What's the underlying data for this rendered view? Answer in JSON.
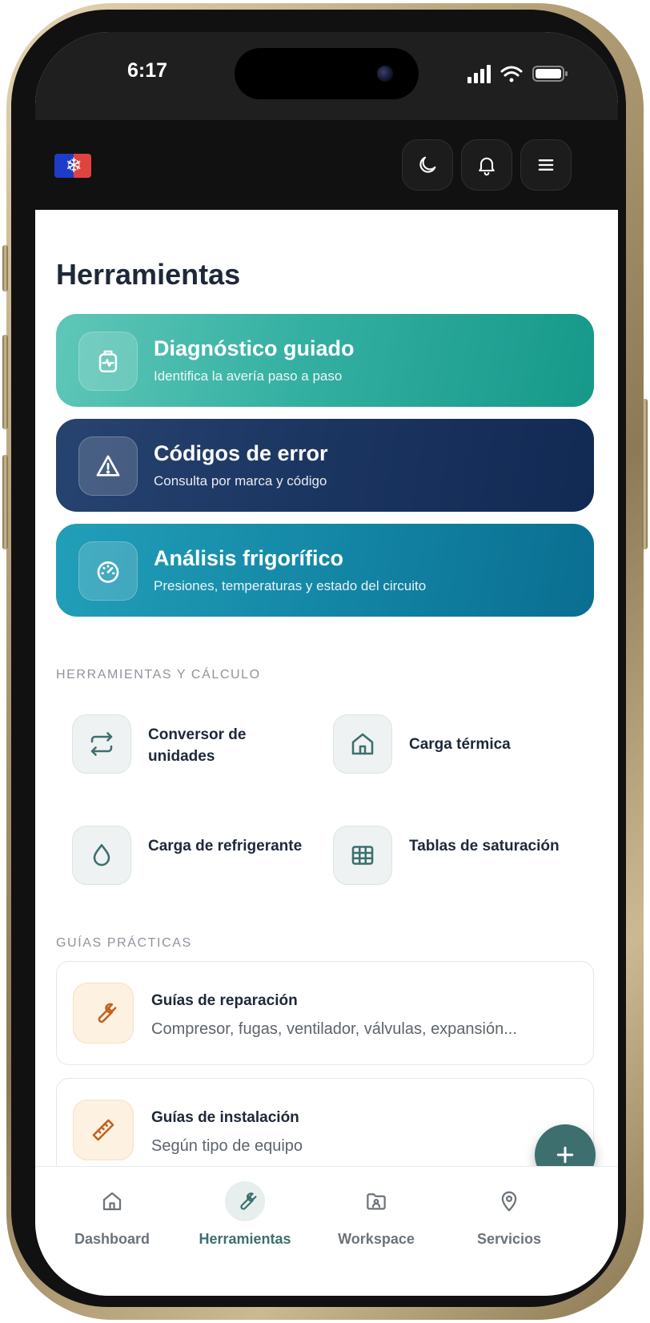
{
  "status_bar": {
    "time": "6:17"
  },
  "header": {
    "logo": "snowflake-flag-logo",
    "buttons": [
      "moon-icon",
      "bell-icon",
      "menu-icon"
    ]
  },
  "page": {
    "title": "Herramientas"
  },
  "hero_cards": [
    {
      "title": "Diagnóstico guiado",
      "subtitle": "Identifica la avería paso a paso",
      "icon": "medical-kit-icon",
      "color_from": "#5fc7b8",
      "color_to": "#16998a"
    },
    {
      "title": "Códigos de error",
      "subtitle": "Consulta por marca y código",
      "icon": "warning-triangle-icon",
      "color_from": "#24406e",
      "color_to": "#122a55"
    },
    {
      "title": "Análisis frigorífico",
      "subtitle": "Presiones, temperaturas y estado del circuito",
      "icon": "gauge-icon",
      "color_from": "#1f9bb5",
      "color_to": "#0a6f92"
    }
  ],
  "tools_section": {
    "label": "HERRAMIENTAS Y CÁLCULO",
    "items": [
      {
        "label": "Conversor de unidades",
        "icon": "swap-arrows-icon"
      },
      {
        "label": "Carga térmica",
        "icon": "home-icon"
      },
      {
        "label": "Carga de refrigerante",
        "icon": "droplet-icon"
      },
      {
        "label": "Tablas de saturación",
        "icon": "table-grid-icon"
      }
    ]
  },
  "guides_section": {
    "label": "GUÍAS PRÁCTICAS",
    "items": [
      {
        "title": "Guías de reparación",
        "subtitle": "Compresor, fugas, ventilador, válvulas, expansión...",
        "icon": "wrench-icon"
      },
      {
        "title": "Guías de instalación",
        "subtitle": "Según tipo de equipo",
        "icon": "ruler-icon"
      }
    ]
  },
  "fab": {
    "icon": "plus-icon"
  },
  "bottom_nav": {
    "active": "Herramientas",
    "items": [
      {
        "label": "Dashboard",
        "icon": "home-icon"
      },
      {
        "label": "Herramientas",
        "icon": "wrench-icon"
      },
      {
        "label": "Workspace",
        "icon": "folder-user-icon"
      },
      {
        "label": "Servicios",
        "icon": "map-pin-icon"
      }
    ]
  },
  "colors": {
    "accent": "#3d6f6f",
    "header_bg": "#111111",
    "guide_icon_bg": "#fdf1e1",
    "guide_icon_stroke": "#c2621e"
  }
}
